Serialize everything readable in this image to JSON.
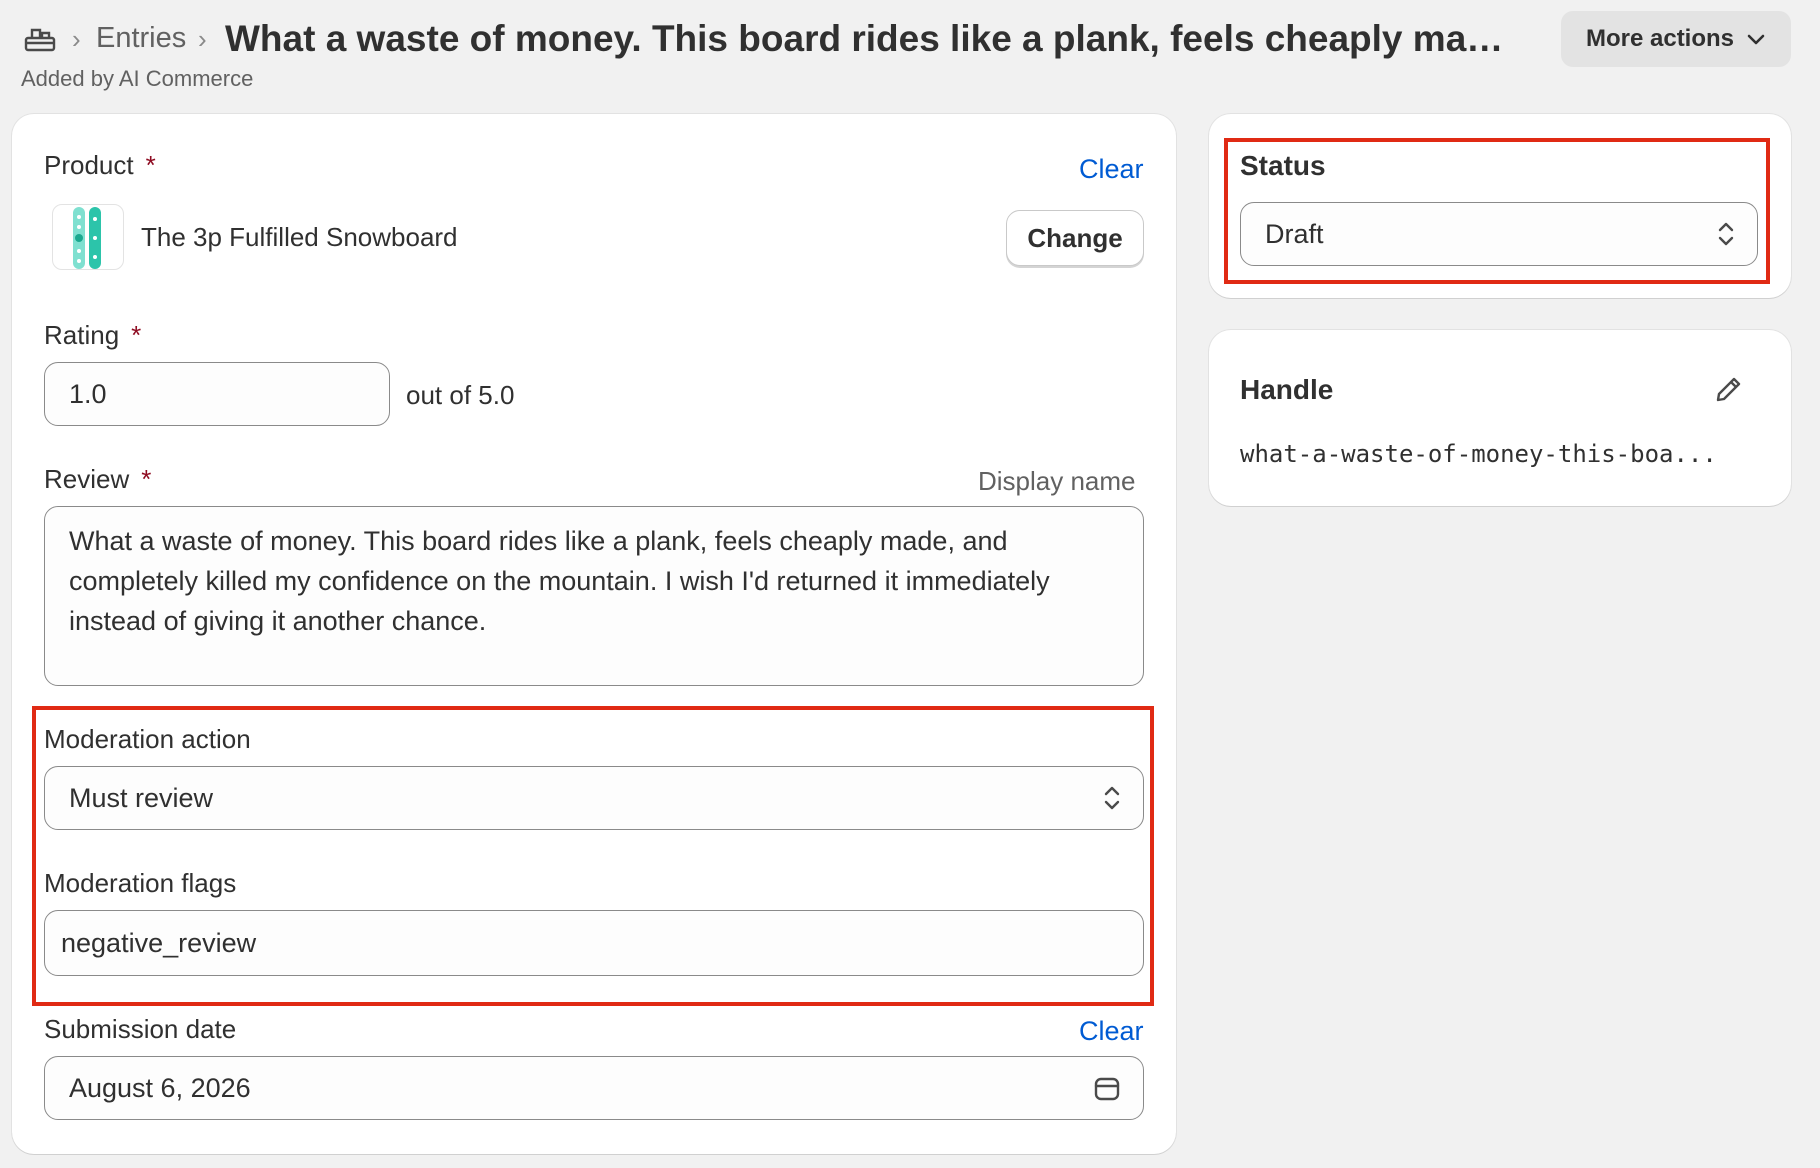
{
  "header": {
    "breadcrumb_entries": "Entries",
    "title": "What a waste of money. This board rides like a plank, feels cheaply made, ...",
    "subtitle": "Added by AI Commerce",
    "more_actions": "More actions",
    "breadcrumb_icon": "metaobject-icon"
  },
  "product": {
    "label": "Product",
    "required_mark": "*",
    "clear": "Clear",
    "name": "The 3p Fulfilled Snowboard",
    "change": "Change"
  },
  "rating": {
    "label": "Rating",
    "required_mark": "*",
    "value": "1.0",
    "suffix": "out of 5.0"
  },
  "review": {
    "label": "Review",
    "required_mark": "*",
    "display_name": "Display name",
    "text": "What a waste of money. This board rides like a plank, feels cheaply made, and completely killed my confidence on the mountain. I wish I'd returned it immediately instead of giving it another chance."
  },
  "moderation_action": {
    "label": "Moderation action",
    "value": "Must review"
  },
  "moderation_flags": {
    "label": "Moderation flags",
    "value": "negative_review"
  },
  "submission_date": {
    "label": "Submission date",
    "clear": "Clear",
    "value": "August 6, 2026"
  },
  "status": {
    "title": "Status",
    "value": "Draft"
  },
  "handle": {
    "title": "Handle",
    "value": "what-a-waste-of-money-this-boa..."
  },
  "colors": {
    "highlight": "#e02a14",
    "link": "#005bd3",
    "required": "#8e0b21",
    "background": "#f1f1f1"
  }
}
